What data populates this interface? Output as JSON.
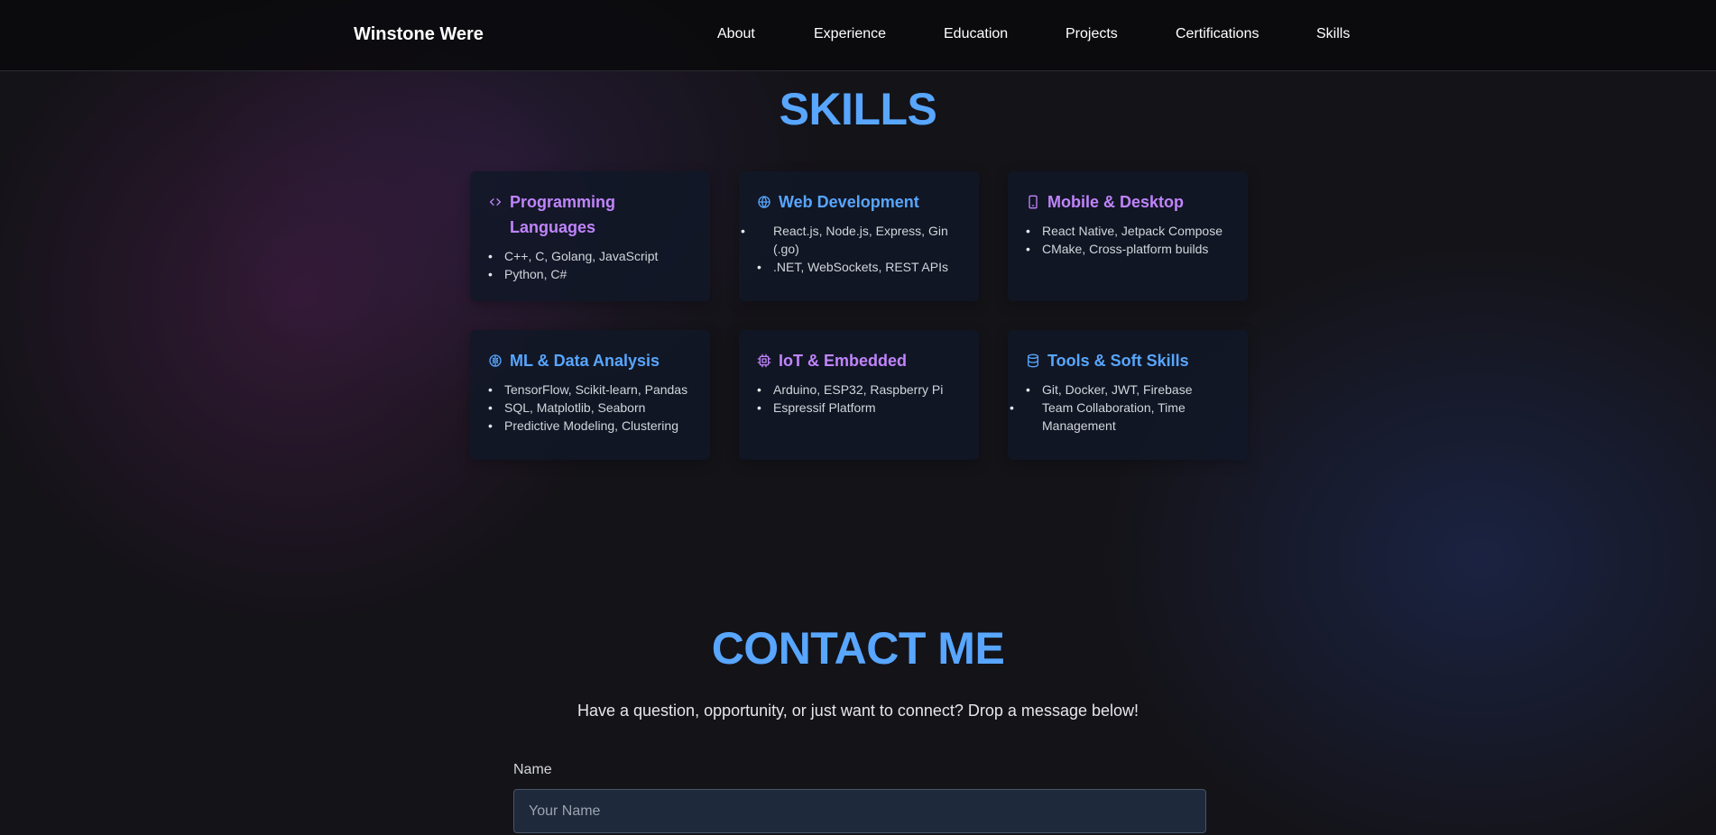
{
  "navbar": {
    "brand": "Winstone Were",
    "links": [
      "About",
      "Experience",
      "Education",
      "Projects",
      "Certifications",
      "Skills"
    ]
  },
  "skills": {
    "title": "SKILLS",
    "cards": [
      {
        "title": "Programming Languages",
        "icon": "code-icon",
        "color": "#c084fc",
        "items": [
          "C++, C, Golang, JavaScript",
          "Python, C#"
        ]
      },
      {
        "title": "Web Development",
        "icon": "globe-icon",
        "color": "#58a6ff",
        "items": [
          "React.js, Node.js, Express, Gin (.go)",
          ".NET, WebSockets, REST APIs"
        ]
      },
      {
        "title": "Mobile & Desktop",
        "icon": "smartphone-icon",
        "color": "#c084fc",
        "items": [
          "React Native, Jetpack Compose",
          "CMake, Cross-platform builds"
        ]
      },
      {
        "title": "ML & Data Analysis",
        "icon": "brain-icon",
        "color": "#58a6ff",
        "items": [
          "TensorFlow, Scikit-learn, Pandas",
          "SQL, Matplotlib, Seaborn",
          "Predictive Modeling, Clustering"
        ]
      },
      {
        "title": "IoT & Embedded",
        "icon": "cpu-icon",
        "color": "#c084fc",
        "items": [
          "Arduino, ESP32, Raspberry Pi",
          "Espressif Platform"
        ]
      },
      {
        "title": "Tools & Soft Skills",
        "icon": "database-icon",
        "color": "#58a6ff",
        "items": [
          "Git, Docker, JWT, Firebase",
          "Team Collaboration, Time Management"
        ]
      }
    ]
  },
  "contact": {
    "title": "CONTACT ME",
    "subtitle": "Have a question, opportunity, or just want to connect? Drop a message below!",
    "name_label": "Name",
    "name_placeholder": "Your Name"
  }
}
